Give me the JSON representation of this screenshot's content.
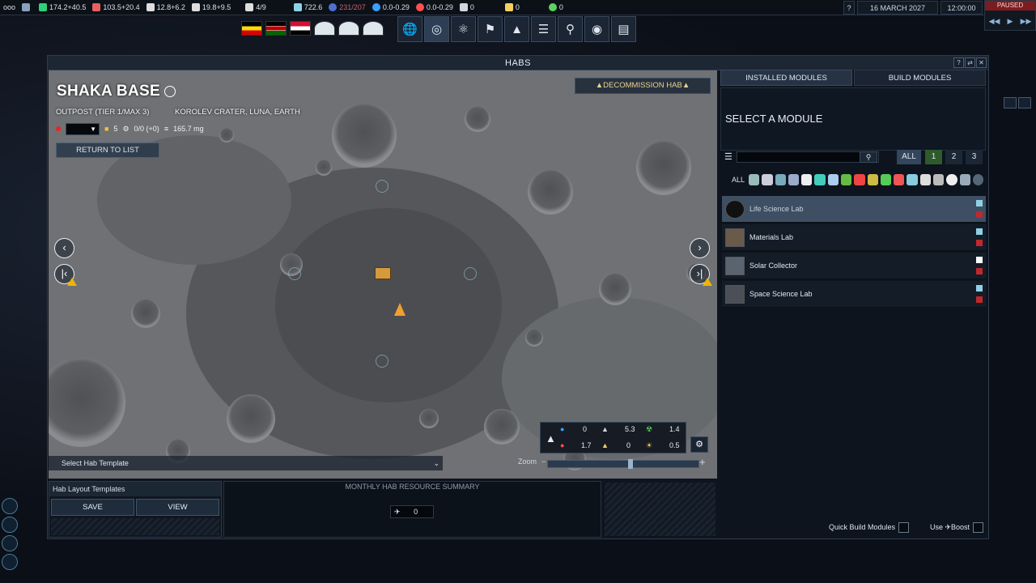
{
  "topbar": {
    "menu_glyph": "ooo",
    "resources": [
      {
        "name": "influence",
        "value": "174.2+40.5",
        "color": "#2fd07a",
        "icon": "influence-icon"
      },
      {
        "name": "ops",
        "value": "103.5+20.4",
        "color": "#e86060",
        "icon": "ops-icon"
      },
      {
        "name": "boost",
        "value": "12.8+6.2",
        "color": "#dddddd",
        "icon": "boost-icon"
      },
      {
        "name": "mission_control",
        "value": "19.8+9.5",
        "color": "#dddddd",
        "icon": "mission-control-icon"
      },
      {
        "name": "control_points",
        "value": "4/9",
        "color": "#dddddd",
        "icon": "satellite-icon"
      },
      {
        "name": "research",
        "value": "722.6",
        "color": "#8fd0e8",
        "icon": "research-flask-icon"
      },
      {
        "name": "habs",
        "value": "231/207",
        "color": "#c8646a",
        "icon": "hab-orb-icon",
        "warn": true
      },
      {
        "name": "water",
        "value": "0.0-0.29",
        "color": "#3aa0ff",
        "icon": "water-icon"
      },
      {
        "name": "volatiles",
        "value": "0.0-0.29",
        "color": "#ff5050",
        "icon": "volatiles-icon"
      },
      {
        "name": "metals",
        "value": "0",
        "color": "#cfd8e0",
        "icon": "metals-icon"
      },
      {
        "name": "noble_metals",
        "value": "0",
        "color": "#f5d060",
        "icon": "noble-metals-icon"
      },
      {
        "name": "fissiles",
        "value": "0",
        "color": "#60d060",
        "icon": "fissiles-icon"
      }
    ],
    "help": "?",
    "date": "16 MARCH 2027",
    "time": "12:00:00",
    "paused": "PAUSED"
  },
  "nav_buttons": [
    "globe-icon",
    "orbit-icon",
    "org-icon",
    "flag-icon",
    "council-icon",
    "balance-icon",
    "location-icon",
    "mind-icon",
    "log-icon"
  ],
  "panel": {
    "title": "HABS",
    "base_name": "SHAKA BASE",
    "tier": "OUTPOST (TIER 1/MAX 3)",
    "location": "KOROLEV CRATER, LUNA, EARTH",
    "crew": "5",
    "ratio": "0/0 (+0)",
    "mass": "165.7 mg",
    "return_label": "RETURN TO LIST",
    "decommission_label": "▲DECOMMISSION HAB▲",
    "template_select": "Select Hab Template",
    "zoom_label": "Zoom",
    "zoom_level": 0.55,
    "resource_summary": {
      "water": "0",
      "volatiles": "1.7",
      "metals": "5.3",
      "noble": "0",
      "fissiles": "1.4",
      "energy": "0.5"
    },
    "layout_templates_label": "Hab Layout Templates",
    "save_label": "SAVE",
    "view_label": "VIEW",
    "monthly_summary_label": "MONTHLY HAB RESOURCE SUMMARY",
    "monthly_boost": "0"
  },
  "sidepanel": {
    "tab_installed": "INSTALLED MODULES",
    "tab_build": "BUILD MODULES",
    "select_header": "SELECT A MODULE",
    "tier_all": "ALL",
    "tier_1": "1",
    "tier_2": "2",
    "tier_3": "3",
    "cat_all": "ALL",
    "modules": [
      {
        "name": "Life Science Lab",
        "tag_color": "#8fd0e8"
      },
      {
        "name": "Materials Lab",
        "tag_color": "#8fd0e8"
      },
      {
        "name": "Solar Collector",
        "tag_color": "#ffffff"
      },
      {
        "name": "Space Science Lab",
        "tag_color": "#8fd0e8"
      }
    ],
    "quick_build": "Quick Build Modules",
    "use_boost": "Use ✈Boost"
  }
}
